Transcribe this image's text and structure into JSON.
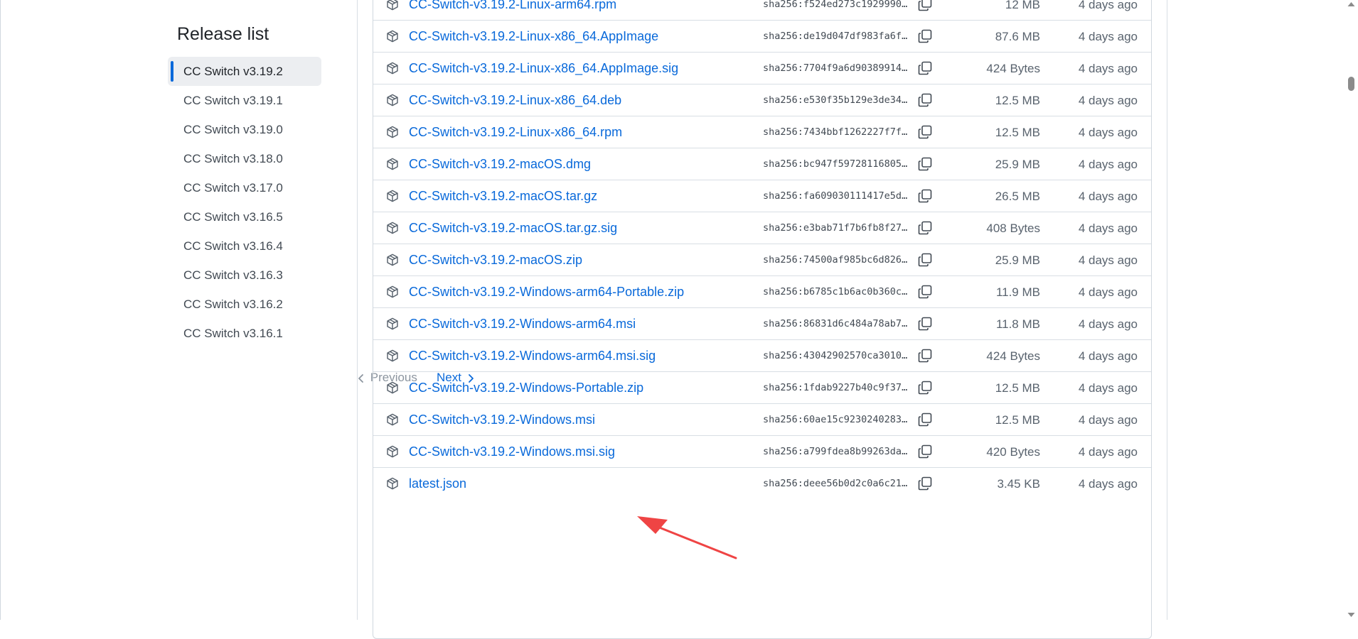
{
  "sidebar": {
    "title": "Release list",
    "releases": [
      {
        "label": "CC Switch v3.19.2",
        "active": true
      },
      {
        "label": "CC Switch v3.19.1",
        "active": false
      },
      {
        "label": "CC Switch v3.19.0",
        "active": false
      },
      {
        "label": "CC Switch v3.18.0",
        "active": false
      },
      {
        "label": "CC Switch v3.17.0",
        "active": false
      },
      {
        "label": "CC Switch v3.16.5",
        "active": false
      },
      {
        "label": "CC Switch v3.16.4",
        "active": false
      },
      {
        "label": "CC Switch v3.16.3",
        "active": false
      },
      {
        "label": "CC Switch v3.16.2",
        "active": false
      },
      {
        "label": "CC Switch v3.16.1",
        "active": false
      }
    ],
    "pagination": {
      "previous_label": "Previous",
      "next_label": "Next",
      "previous_enabled": false
    }
  },
  "assets": [
    {
      "name": "CC-Switch-v3.19.2-Linux-arm64.rpm",
      "sha": "sha256:f524ed273c1929990…",
      "size": "12 MB",
      "date": "4 days ago"
    },
    {
      "name": "CC-Switch-v3.19.2-Linux-x86_64.AppImage",
      "sha": "sha256:de19d047df983fa6f…",
      "size": "87.6 MB",
      "date": "4 days ago"
    },
    {
      "name": "CC-Switch-v3.19.2-Linux-x86_64.AppImage.sig",
      "sha": "sha256:7704f9a6d90389914…",
      "size": "424 Bytes",
      "date": "4 days ago"
    },
    {
      "name": "CC-Switch-v3.19.2-Linux-x86_64.deb",
      "sha": "sha256:e530f35b129e3de34…",
      "size": "12.5 MB",
      "date": "4 days ago"
    },
    {
      "name": "CC-Switch-v3.19.2-Linux-x86_64.rpm",
      "sha": "sha256:7434bbf1262227f7f…",
      "size": "12.5 MB",
      "date": "4 days ago"
    },
    {
      "name": "CC-Switch-v3.19.2-macOS.dmg",
      "sha": "sha256:bc947f59728116805…",
      "size": "25.9 MB",
      "date": "4 days ago"
    },
    {
      "name": "CC-Switch-v3.19.2-macOS.tar.gz",
      "sha": "sha256:fa609030111417e5d…",
      "size": "26.5 MB",
      "date": "4 days ago"
    },
    {
      "name": "CC-Switch-v3.19.2-macOS.tar.gz.sig",
      "sha": "sha256:e3bab71f7b6fb8f27…",
      "size": "408 Bytes",
      "date": "4 days ago"
    },
    {
      "name": "CC-Switch-v3.19.2-macOS.zip",
      "sha": "sha256:74500af985bc6d826…",
      "size": "25.9 MB",
      "date": "4 days ago"
    },
    {
      "name": "CC-Switch-v3.19.2-Windows-arm64-Portable.zip",
      "sha": "sha256:b6785c1b6ac0b360c…",
      "size": "11.9 MB",
      "date": "4 days ago"
    },
    {
      "name": "CC-Switch-v3.19.2-Windows-arm64.msi",
      "sha": "sha256:86831d6c484a78ab7…",
      "size": "11.8 MB",
      "date": "4 days ago"
    },
    {
      "name": "CC-Switch-v3.19.2-Windows-arm64.msi.sig",
      "sha": "sha256:43042902570ca3010…",
      "size": "424 Bytes",
      "date": "4 days ago"
    },
    {
      "name": "CC-Switch-v3.19.2-Windows-Portable.zip",
      "sha": "sha256:1fdab9227b40c9f37…",
      "size": "12.5 MB",
      "date": "4 days ago"
    },
    {
      "name": "CC-Switch-v3.19.2-Windows.msi",
      "sha": "sha256:60ae15c9230240283…",
      "size": "12.5 MB",
      "date": "4 days ago"
    },
    {
      "name": "CC-Switch-v3.19.2-Windows.msi.sig",
      "sha": "sha256:a799fdea8b99263da…",
      "size": "420 Bytes",
      "date": "4 days ago"
    },
    {
      "name": "latest.json",
      "sha": "sha256:deee56b0d2c0a6c21…",
      "size": "3.45 KB",
      "date": "4 days ago"
    }
  ],
  "icons": {
    "asset": "package-icon",
    "copy": "copy-icon",
    "previous": "chevron-left-icon",
    "next": "chevron-right-icon"
  },
  "colors": {
    "link": "#0969da",
    "muted": "#59636e",
    "annotation": "#ef4444",
    "active_indicator": "#0969da"
  },
  "annotation": {
    "points_to": "CC-Switch-v3.19.2-Windows.msi"
  }
}
